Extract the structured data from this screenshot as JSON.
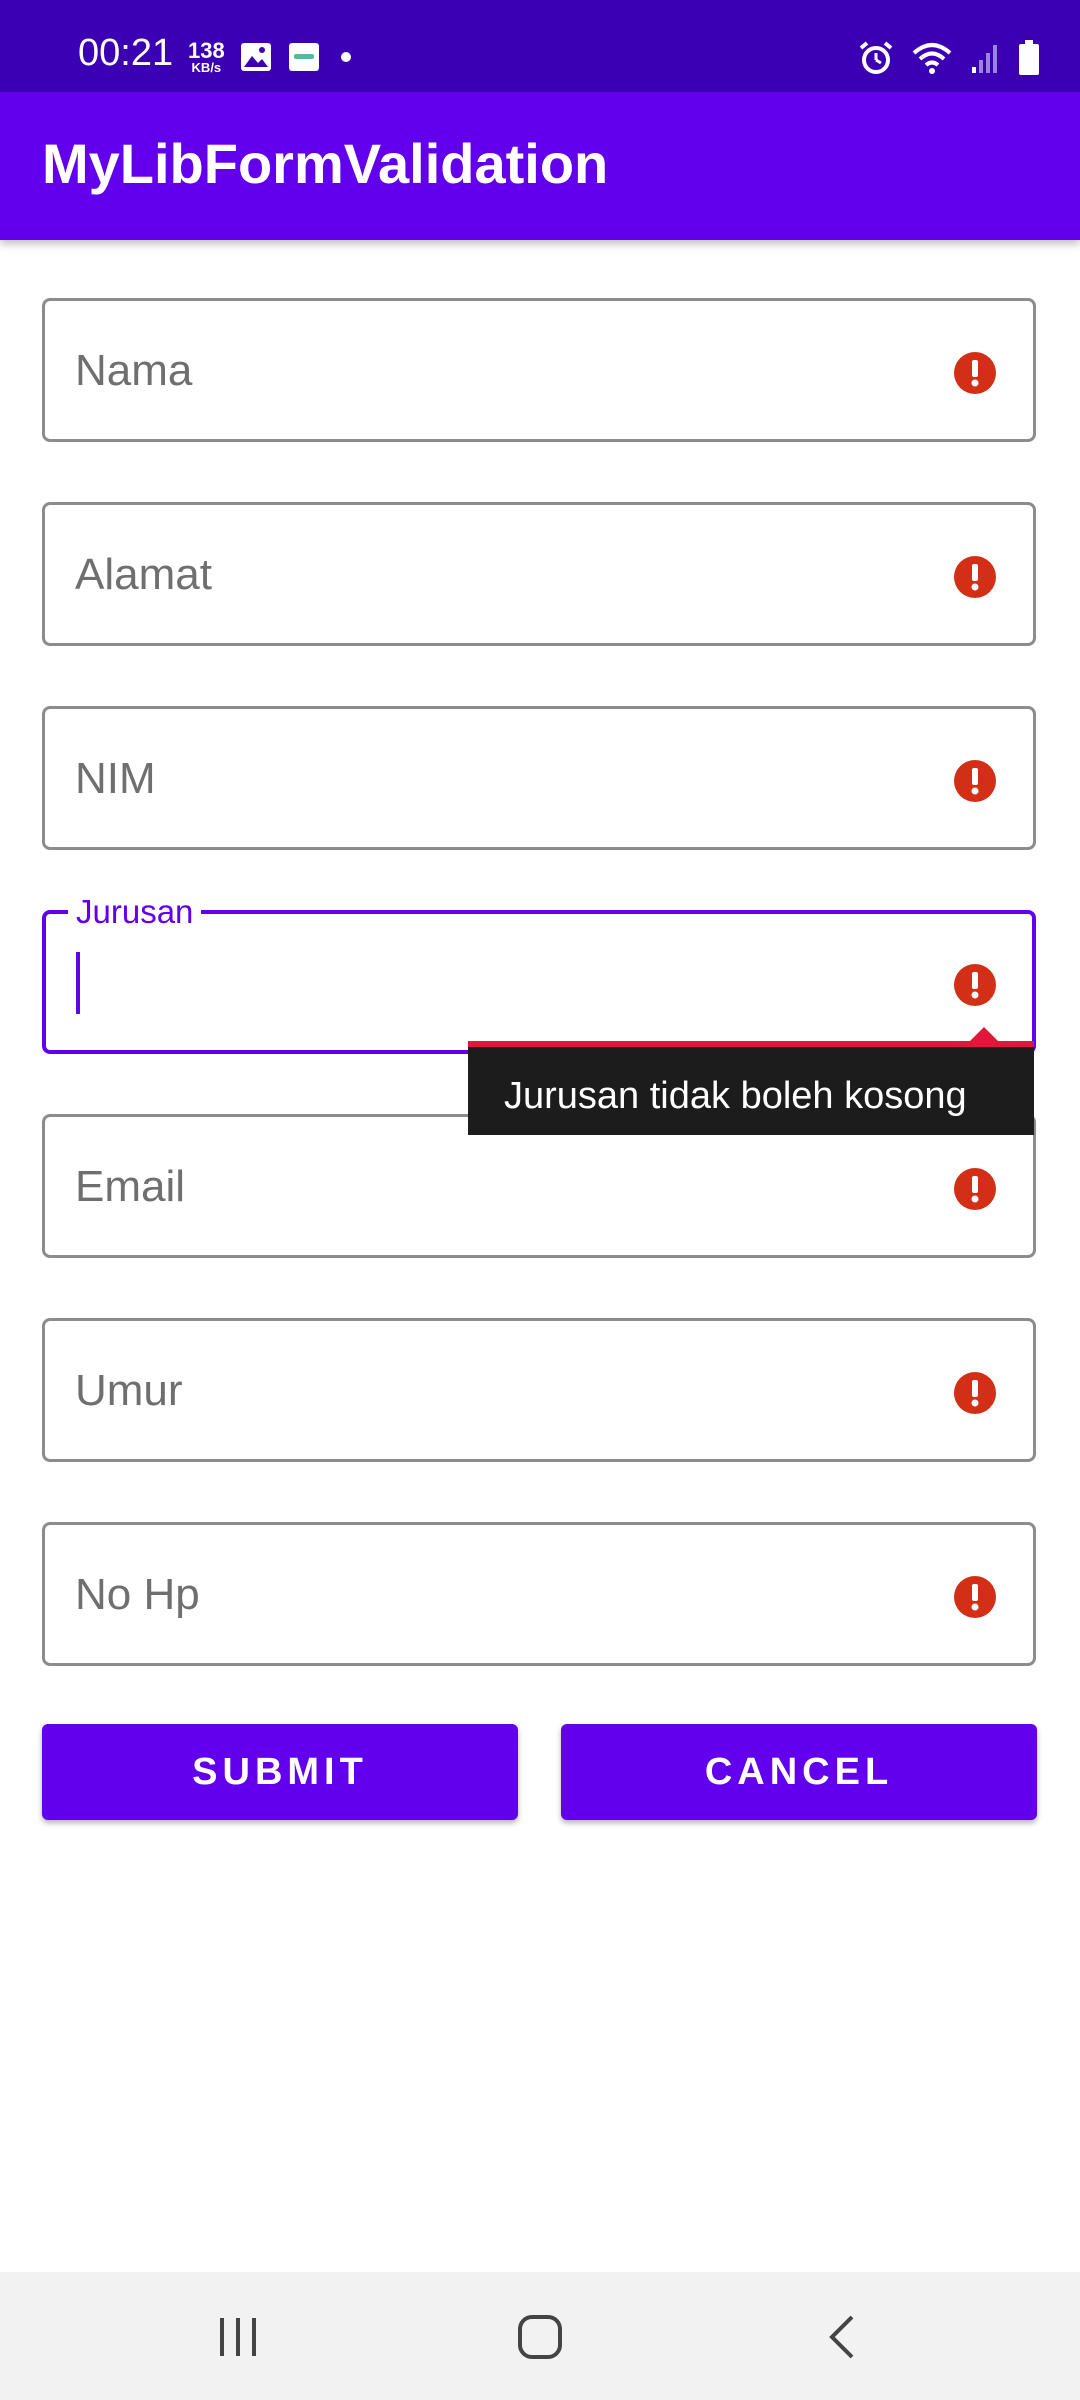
{
  "status_bar": {
    "time": "00:21",
    "speed_value": "138",
    "speed_unit": "KB/s",
    "icons": [
      "image-icon",
      "app-notification-icon",
      "dot-icon",
      "alarm-icon",
      "wifi-icon",
      "signal-icon",
      "battery-icon"
    ]
  },
  "app_bar": {
    "title": "MyLibFormValidation"
  },
  "form": {
    "fields": [
      {
        "hint": "Nama"
      },
      {
        "hint": "Alamat"
      },
      {
        "hint": "NIM"
      },
      {
        "label": "Jurusan",
        "value": ""
      },
      {
        "hint": "Email"
      },
      {
        "hint": "Umur"
      },
      {
        "hint": "No Hp"
      }
    ],
    "error_tooltip": "Jurusan tidak boleh kosong",
    "submit_label": "SUBMIT",
    "cancel_label": "CANCEL"
  },
  "colors": {
    "status_bar": "#3c00b4",
    "primary": "#6200ee",
    "error": "#d32f16",
    "tooltip_accent": "#e0173a"
  },
  "nav_bar": {
    "icons": [
      "recents-icon",
      "home-icon",
      "back-icon"
    ]
  }
}
